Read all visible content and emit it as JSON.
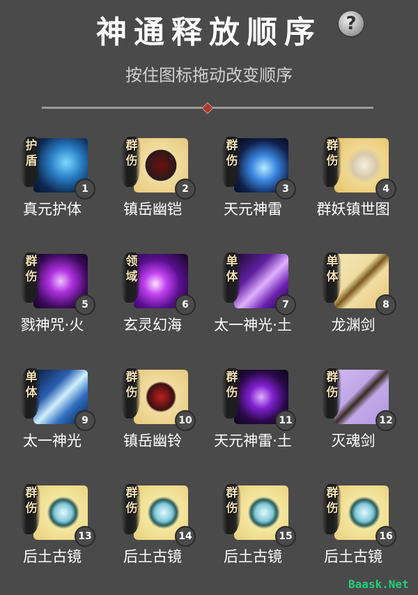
{
  "header": {
    "title": "神通释放顺序",
    "help_label": "?",
    "subtitle": "按住图标拖动改变顺序"
  },
  "skills": [
    {
      "tag": "护盾",
      "number": "1",
      "name": "真元护体",
      "theme": "blue-shield"
    },
    {
      "tag": "群伤",
      "number": "2",
      "name": "镇岳幽铠",
      "theme": "armor"
    },
    {
      "tag": "群伤",
      "number": "3",
      "name": "天元神雷",
      "theme": "thunder"
    },
    {
      "tag": "群伤",
      "number": "4",
      "name": "群妖镇世图",
      "theme": "scroll"
    },
    {
      "tag": "群伤",
      "number": "5",
      "name": "戮神咒·火",
      "theme": "purple-flame"
    },
    {
      "tag": "领域",
      "number": "6",
      "name": "玄灵幻海",
      "theme": "purple-vortex"
    },
    {
      "tag": "单体",
      "number": "7",
      "name": "太一神光·土",
      "theme": "purple-beam"
    },
    {
      "tag": "单体",
      "number": "8",
      "name": "龙渊剑",
      "theme": "sword-gold"
    },
    {
      "tag": "单体",
      "number": "9",
      "name": "太一神光",
      "theme": "blue-beam"
    },
    {
      "tag": "群伤",
      "number": "10",
      "name": "镇岳幽铃",
      "theme": "bell"
    },
    {
      "tag": "群伤",
      "number": "11",
      "name": "天元神雷·土",
      "theme": "purple-thunder"
    },
    {
      "tag": "群伤",
      "number": "12",
      "name": "灭魂剑",
      "theme": "sword-purple"
    },
    {
      "tag": "群伤",
      "number": "13",
      "name": "后土古镜",
      "theme": "mirror"
    },
    {
      "tag": "群伤",
      "number": "14",
      "name": "后土古镜",
      "theme": "mirror"
    },
    {
      "tag": "群伤",
      "number": "15",
      "name": "后土古镜",
      "theme": "mirror"
    },
    {
      "tag": "群伤",
      "number": "16",
      "name": "后土古镜",
      "theme": "mirror"
    }
  ],
  "watermark": "Baask.Net"
}
